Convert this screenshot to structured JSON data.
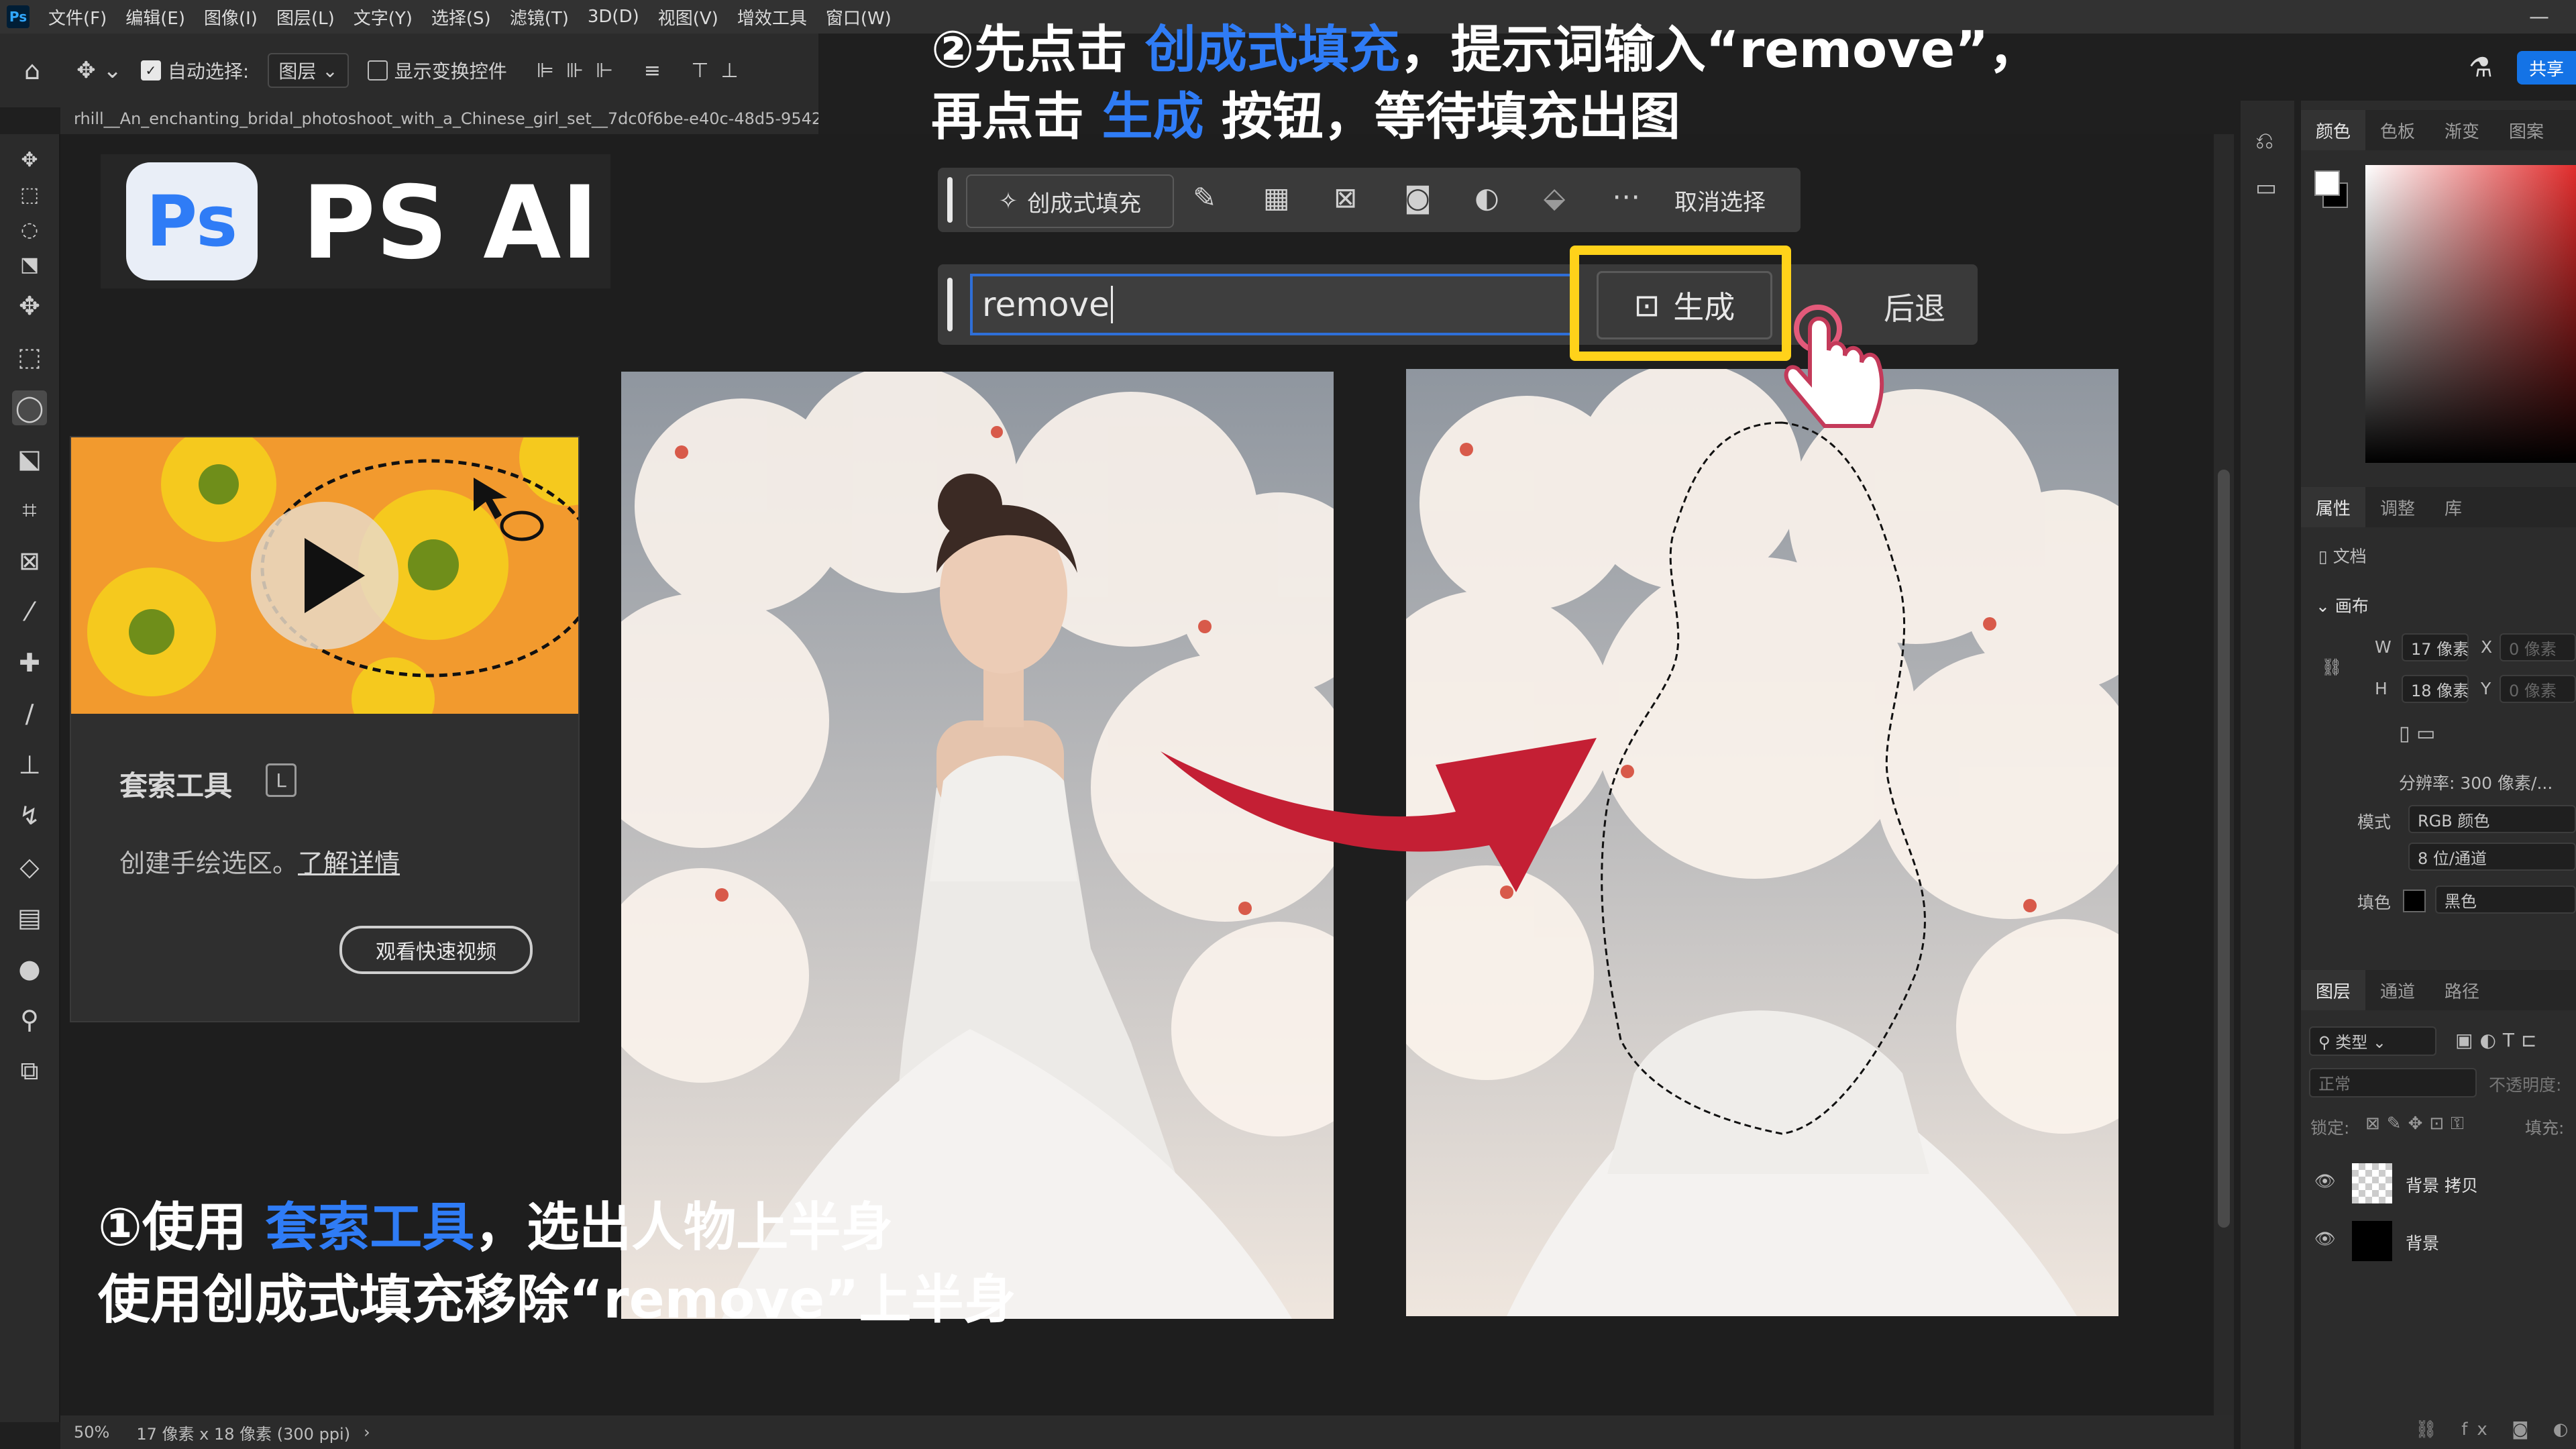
{
  "menubar": {
    "app_icon": "Ps",
    "items": [
      "文件(F)",
      "编辑(E)",
      "图像(I)",
      "图层(L)",
      "文字(Y)",
      "选择(S)",
      "滤镜(T)",
      "3D(D)",
      "视图(V)",
      "增效工具",
      "窗口(W)"
    ],
    "share_label": "共享"
  },
  "options": {
    "auto_select_label": "自动选择:",
    "layer_dropdown": "图层",
    "show_transform_label": "显示变换控件"
  },
  "doc_tab": "rhill__An_enchanting_bridal_photoshoot_with_a_Chinese_girl_set__7dc0f6be-e40c-48d5-9542",
  "logo": {
    "badge": "Ps",
    "title": "PS AI"
  },
  "tooltip": {
    "title": "套索工具",
    "shortcut": "L",
    "desc": "创建手绘选区。",
    "link": "了解详情",
    "video_button": "观看快速视频"
  },
  "instruction_top": {
    "line1_a": "②先点击 ",
    "line1_b": "创成式填充",
    "line1_c": "，提示词输入“remove”，",
    "line2_a": "再点击 ",
    "line2_b": "生成",
    "line2_c": " 按钮，等待填充出图"
  },
  "instruction_bottom": {
    "line1_a": "①使用 ",
    "line1_b": "套索工具",
    "line1_c": "，选出人物上半身",
    "line2": "使用创成式填充移除“remove”上半身"
  },
  "taskbar": {
    "gen_fill": "创成式填充",
    "deselect": "取消选择"
  },
  "prompt": {
    "value": "remove",
    "generate": "生成",
    "back": "后退"
  },
  "right_panel": {
    "color_tabs": [
      "颜色",
      "色板",
      "渐变",
      "图案"
    ],
    "prop_tabs": [
      "属性",
      "调整",
      "库"
    ],
    "doc_label": "文档",
    "canvas_label": "画布",
    "w_label": "W",
    "w_value": "17 像素",
    "h_label": "H",
    "h_value": "18 像素",
    "x_label": "X",
    "y_label": "Y",
    "x_value": "0 像素",
    "y_value": "0 像素",
    "resolution": "分辨率: 300 像素/...",
    "mode_label": "模式",
    "mode_value": "RGB 颜色",
    "depth_value": "8 位/通道",
    "fill_label": "填色",
    "fill_value": "黑色",
    "layer_tabs": [
      "图层",
      "通道",
      "路径"
    ],
    "filter_label": "类型",
    "blend": "正常",
    "opacity": "不透明度:",
    "lock": "锁定:",
    "fill": "填充:",
    "layers": [
      "背景 拷贝",
      "背景"
    ]
  },
  "status": {
    "zoom": "50%",
    "info": "17 像素 x 18 像素 (300 ppi)"
  }
}
